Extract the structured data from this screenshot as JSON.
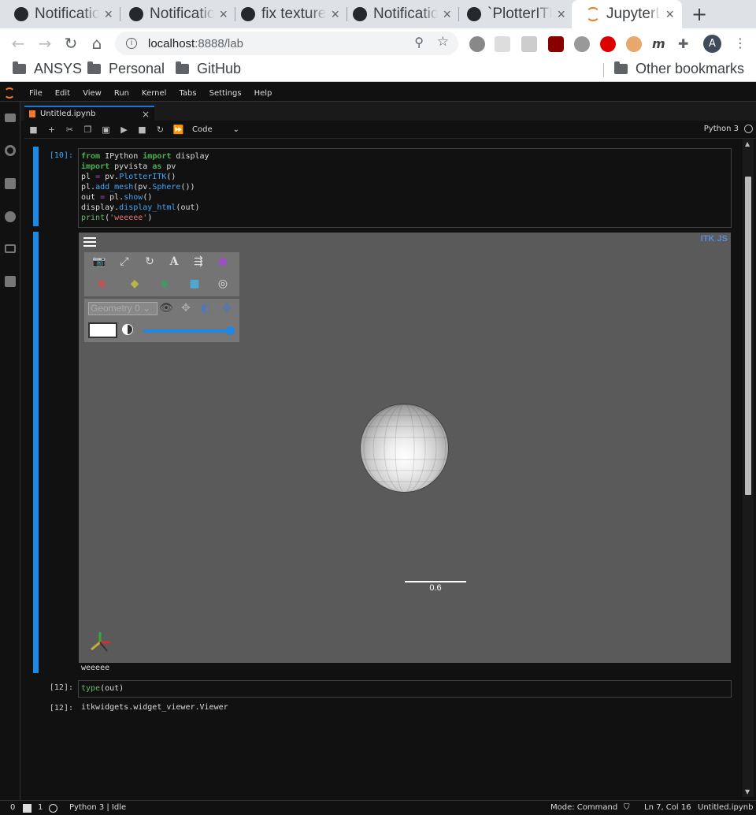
{
  "browser": {
    "tabs": [
      {
        "label": "Notifications",
        "icon": "github-icon"
      },
      {
        "label": "Notifications",
        "icon": "github-icon"
      },
      {
        "label": "fix texture",
        "icon": "github-icon"
      },
      {
        "label": "Notifications",
        "icon": "github-icon"
      },
      {
        "label": "`PlotterITK`",
        "icon": "github-icon"
      },
      {
        "label": "JupyterLab",
        "icon": "jupyter-icon"
      }
    ],
    "new_tab": "+",
    "url_host": "localhost",
    "url_path": ":8888/lab",
    "profile_initial": "A",
    "bookmarks": [
      "ANSYS",
      "Personal",
      "GitHub"
    ],
    "other_bookmarks": "Other bookmarks"
  },
  "jupyter": {
    "menu": [
      "File",
      "Edit",
      "View",
      "Run",
      "Kernel",
      "Tabs",
      "Settings",
      "Help"
    ],
    "doc_tab": "Untitled.ipynb",
    "cell_type": "Code",
    "kernel_name": "Python 3",
    "cells": {
      "c1_prompt": "[10]:",
      "c1_output_text": "weeeee",
      "c2_prompt": "[12]:",
      "c2_code": "type(out)",
      "c2_out_prompt": "[12]:",
      "c2_output": "itkwidgets.widget_viewer.Viewer"
    },
    "viewer": {
      "geometry_select": "Geometry 0",
      "scale_label": "0.6",
      "logo": "ITK JS"
    },
    "status": {
      "terminals": "0",
      "kernels": "1",
      "kernel_state": "Python 3 | Idle",
      "mode": "Mode: Command",
      "cursor": "Ln 7, Col 16",
      "file": "Untitled.ipynb"
    }
  }
}
